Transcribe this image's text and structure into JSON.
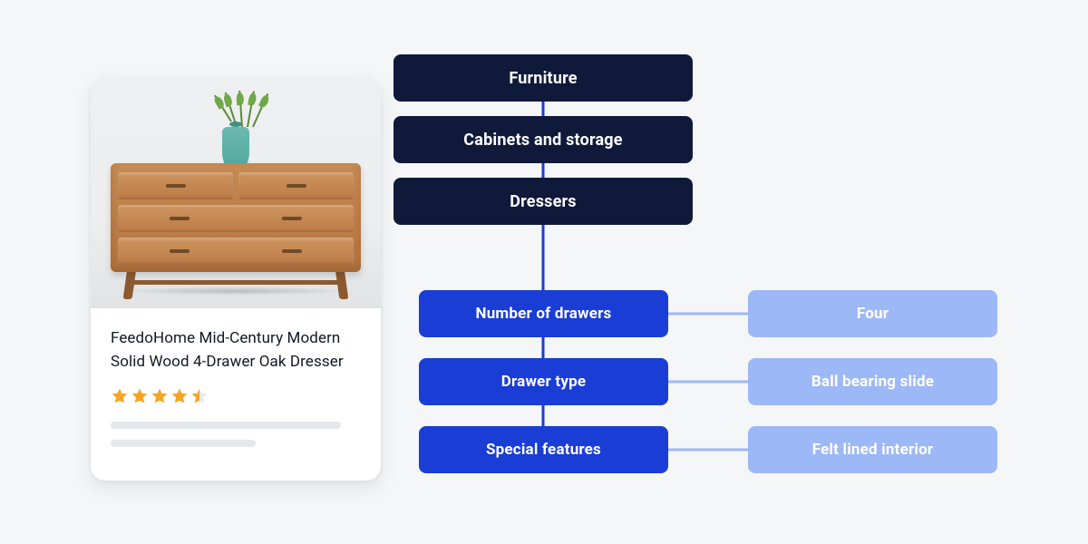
{
  "product": {
    "title": "FeedoHome Mid-Century Modern Solid Wood 4-Drawer Oak Dresser",
    "rating": 4.5,
    "rating_max": 5
  },
  "category_path": [
    "Furniture",
    "Cabinets and storage",
    "Dressers"
  ],
  "attributes": [
    {
      "name": "Number of drawers",
      "value": "Four"
    },
    {
      "name": "Drawer type",
      "value": "Ball bearing slide"
    },
    {
      "name": "Special features",
      "value": "Felt lined interior"
    }
  ],
  "colors": {
    "category_node": "#0f1a3a",
    "attribute_name": "#1a3dd6",
    "attribute_value": "#9db8f6",
    "star": "#f5a524",
    "connector": "#1a3dd6"
  }
}
